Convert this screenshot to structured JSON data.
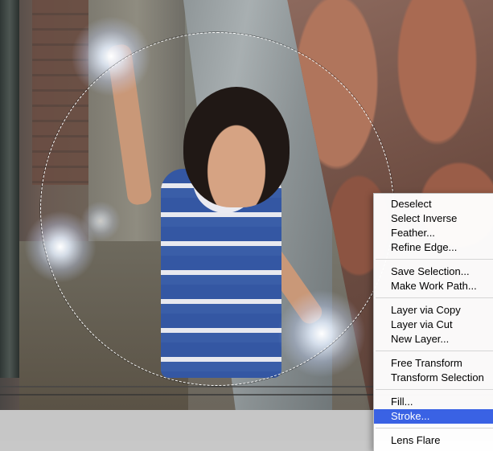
{
  "context_menu": {
    "groups": [
      [
        "Deselect",
        "Select Inverse",
        "Feather...",
        "Refine Edge..."
      ],
      [
        "Save Selection...",
        "Make Work Path..."
      ],
      [
        "Layer via Copy",
        "Layer via Cut",
        "New Layer..."
      ],
      [
        "Free Transform",
        "Transform Selection"
      ],
      [
        "Fill...",
        "Stroke..."
      ],
      [
        "Lens Flare"
      ]
    ],
    "highlighted": "Stroke..."
  },
  "canvas": {
    "selection_shape": "ellipse",
    "flare_count": 4
  }
}
